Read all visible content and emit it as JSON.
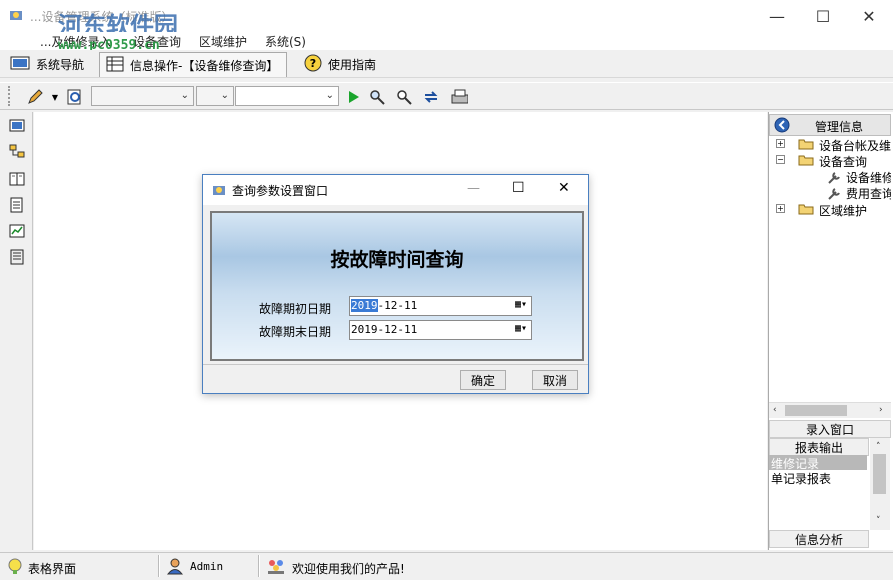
{
  "window": {
    "title": "...设备管理系统（标准版）",
    "minimize": "—",
    "maximize": "☐",
    "close": "✕"
  },
  "watermark": {
    "brand": "河东软件园",
    "url": "www.pc0359.cn"
  },
  "menu": [
    "...及维修录入",
    "设备查询",
    "区域维护",
    "系统(S)"
  ],
  "tabs": [
    {
      "label": "系统导航",
      "icon": "monitor-icon"
    },
    {
      "label": "信息操作-【设备维修查询】",
      "icon": "table-icon"
    },
    {
      "label": "使用指南",
      "icon": "help-icon"
    }
  ],
  "right_panel": {
    "header": "管理信息",
    "tree": [
      {
        "label": "设备台帐及维",
        "expander": "+"
      },
      {
        "label": "设备查询",
        "expander": "−"
      },
      {
        "label": "设备维修",
        "child": true
      },
      {
        "label": "费用查询",
        "child": true
      },
      {
        "label": "区域维护",
        "expander": "+"
      }
    ],
    "buttons": [
      "录入窗口",
      "报表输出"
    ],
    "list": [
      {
        "label": "维修记录",
        "selected": true
      },
      {
        "label": "单记录报表",
        "selected": false
      }
    ],
    "footer": "信息分析"
  },
  "dialog": {
    "title": "查询参数设置窗口",
    "heading": "按故障时间查询",
    "start_label": "故障期初日期",
    "start_year": "2019",
    "start_rest": "-12-11",
    "end_label": "故障期末日期",
    "end_value": "2019-12-11",
    "ok": "确定",
    "cancel": "取消",
    "minimize": "—",
    "maximize": "☐",
    "close": "✕"
  },
  "status": {
    "screen": "表格界面",
    "user": "Admin",
    "welcome": "欢迎使用我们的产品!"
  },
  "colors": {
    "accent": "#4a7fc0",
    "selection": "#b8b8b8",
    "dialog_gradient_mid": "#a9c7e3"
  }
}
